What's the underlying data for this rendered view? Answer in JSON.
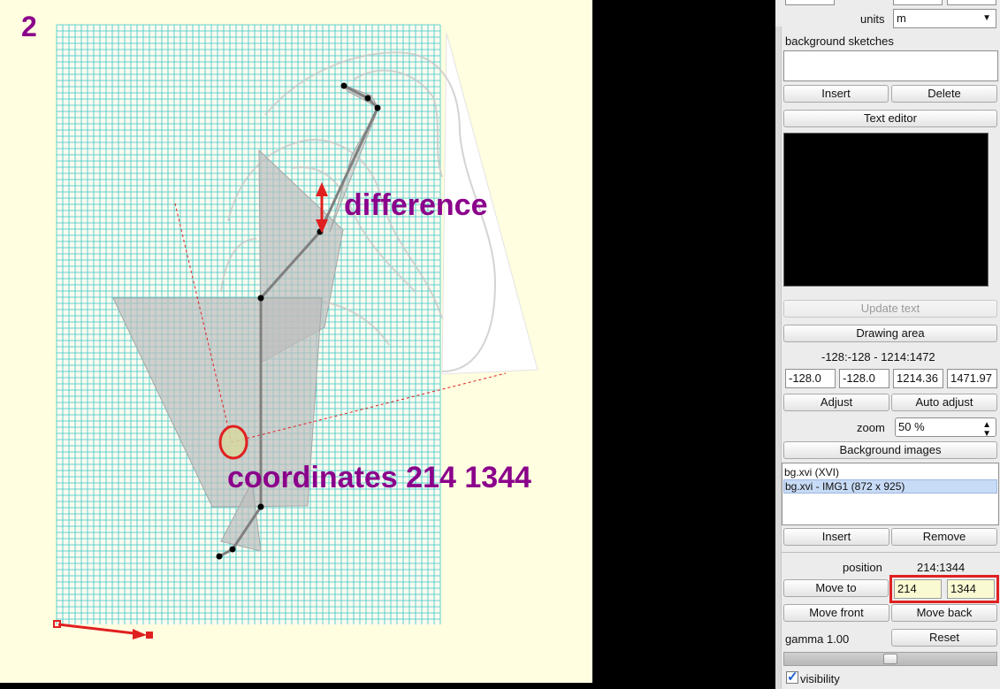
{
  "canvas": {
    "step_number": "2",
    "annotation_difference": "difference",
    "annotation_coordinates": "coordinates 214 1344",
    "grid_color": "#38c6c6",
    "annotation_color": "#8b008b",
    "marker_color": "#e02020"
  },
  "panel": {
    "units_label": "units",
    "units_value": "m",
    "background_sketches_label": "background sketches",
    "insert_label": "Insert",
    "delete_label": "Delete",
    "text_editor_label": "Text editor",
    "update_text_label": "Update text",
    "drawing_area_label": "Drawing area",
    "range_readout": "-128:-128 - 1214:1472",
    "range_fields": [
      "-128.0",
      "-128.0",
      "1214.36",
      "1471.97"
    ],
    "adjust_label": "Adjust",
    "auto_adjust_label": "Auto adjust",
    "zoom_label": "zoom",
    "zoom_value": "50 %",
    "background_images_label": "Background images",
    "images": [
      {
        "label": "bg.xvi (XVI)",
        "selected": false
      },
      {
        "label": "bg.xvi - IMG1 (872 x 925)",
        "selected": true
      }
    ],
    "insert2_label": "Insert",
    "remove_label": "Remove",
    "position_label": "position",
    "position_value": "214:1344",
    "move_to_label": "Move to",
    "pos_x": "214",
    "pos_y": "1344",
    "move_front_label": "Move front",
    "move_back_label": "Move back",
    "gamma_label": "gamma 1.00",
    "reset_label": "Reset",
    "gamma_level": 0.5,
    "visibility_label": "visibility",
    "visibility_checked": true,
    "highlight_color": "#e02020"
  }
}
